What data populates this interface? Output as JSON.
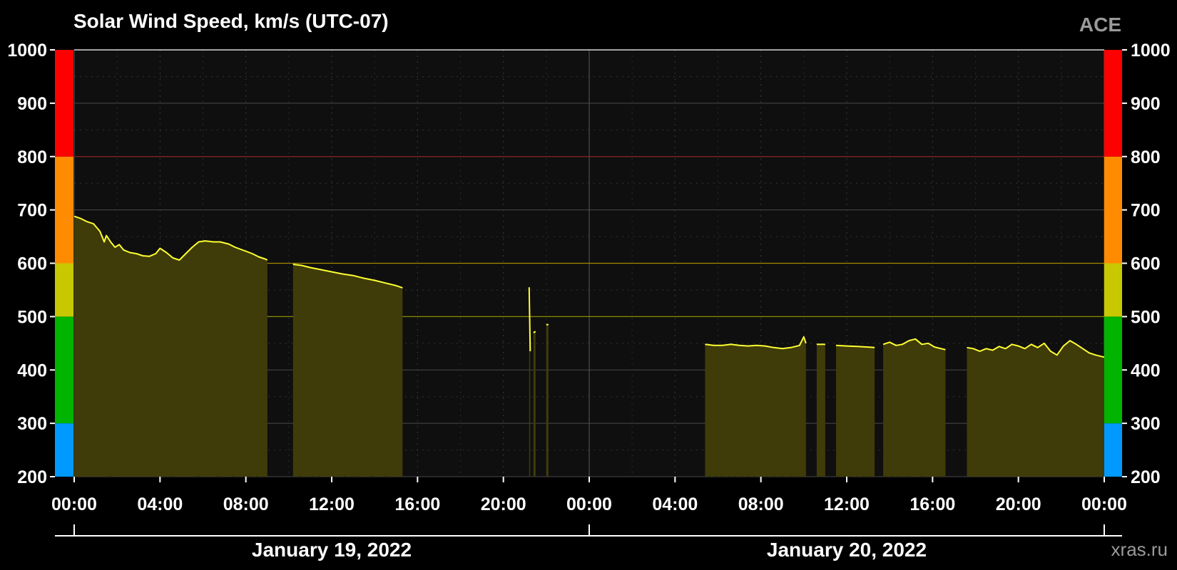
{
  "chart_data": {
    "type": "area",
    "title": "Solar Wind Speed, km/s (UTC-07)",
    "source_label": "ACE",
    "site_label": "xras.ru",
    "ylim": [
      200,
      1000
    ],
    "y_ticks": [
      "1000",
      "900",
      "800",
      "700",
      "600",
      "500",
      "400",
      "300",
      "200"
    ],
    "x_range_hours": [
      0,
      48
    ],
    "x_ticks": [
      "00:00",
      "04:00",
      "08:00",
      "12:00",
      "16:00",
      "20:00",
      "00:00",
      "04:00",
      "08:00",
      "12:00",
      "16:00",
      "20:00",
      "00:00"
    ],
    "dates": [
      "January 19, 2022",
      "January 20, 2022"
    ],
    "grid": true,
    "colors": {
      "line": "#ffff33",
      "fill": "#3f3c09",
      "plot_bg": "#0f0f0f",
      "grid": "#4a4a4a",
      "level_line_600": "#a48a00",
      "level_line_800": "#8a1e1e",
      "level_line_500": "#8a8a00"
    },
    "levels": [
      {
        "from": 200,
        "to": 300,
        "color": "#0099ff"
      },
      {
        "from": 300,
        "to": 500,
        "color": "#00b400"
      },
      {
        "from": 500,
        "to": 600,
        "color": "#c8c800"
      },
      {
        "from": 600,
        "to": 800,
        "color": "#ff8c00"
      },
      {
        "from": 800,
        "to": 1000,
        "color": "#ff0000"
      }
    ],
    "series": [
      {
        "segments": [
          [
            [
              0.0,
              688
            ],
            [
              0.3,
              684
            ],
            [
              0.6,
              678
            ],
            [
              0.9,
              674
            ],
            [
              1.2,
              660
            ],
            [
              1.4,
              640
            ],
            [
              1.5,
              652
            ],
            [
              1.7,
              640
            ],
            [
              1.9,
              630
            ],
            [
              2.1,
              635
            ],
            [
              2.3,
              625
            ],
            [
              2.6,
              620
            ],
            [
              2.9,
              618
            ],
            [
              3.2,
              614
            ],
            [
              3.5,
              613
            ],
            [
              3.8,
              618
            ],
            [
              4.0,
              628
            ],
            [
              4.3,
              620
            ],
            [
              4.6,
              610
            ],
            [
              4.9,
              606
            ],
            [
              5.2,
              618
            ],
            [
              5.5,
              630
            ],
            [
              5.8,
              640
            ],
            [
              6.1,
              642
            ],
            [
              6.5,
              640
            ],
            [
              6.8,
              640
            ],
            [
              7.2,
              636
            ],
            [
              7.5,
              630
            ],
            [
              7.9,
              624
            ],
            [
              8.3,
              618
            ],
            [
              8.6,
              612
            ],
            [
              8.9,
              608
            ],
            [
              9.0,
              606
            ]
          ],
          [
            [
              10.2,
              598
            ],
            [
              10.6,
              596
            ],
            [
              11.0,
              592
            ],
            [
              11.5,
              588
            ],
            [
              12.0,
              584
            ],
            [
              12.5,
              580
            ],
            [
              13.0,
              577
            ],
            [
              13.5,
              572
            ],
            [
              14.0,
              568
            ],
            [
              14.5,
              563
            ],
            [
              15.0,
              558
            ],
            [
              15.3,
              554
            ]
          ],
          [
            [
              21.2,
              555
            ],
            [
              21.25,
              435
            ]
          ],
          [
            [
              21.4,
              470
            ],
            [
              21.5,
              472
            ]
          ],
          [
            [
              22.0,
              485
            ],
            [
              22.1,
              485
            ]
          ],
          [
            [
              29.4,
              448
            ],
            [
              29.8,
              446
            ],
            [
              30.2,
              446
            ],
            [
              30.6,
              448
            ],
            [
              31.0,
              446
            ],
            [
              31.4,
              445
            ],
            [
              31.8,
              446
            ],
            [
              32.2,
              445
            ],
            [
              32.6,
              442
            ],
            [
              33.0,
              440
            ],
            [
              33.4,
              442
            ],
            [
              33.8,
              446
            ],
            [
              34.0,
              462
            ],
            [
              34.1,
              450
            ]
          ],
          [
            [
              34.6,
              448
            ],
            [
              35.0,
              448
            ]
          ],
          [
            [
              35.5,
              446
            ],
            [
              36.0,
              445
            ],
            [
              36.5,
              444
            ],
            [
              37.0,
              443
            ],
            [
              37.3,
              442
            ]
          ],
          [
            [
              37.7,
              448
            ],
            [
              38.0,
              452
            ],
            [
              38.3,
              446
            ],
            [
              38.6,
              448
            ],
            [
              38.9,
              455
            ],
            [
              39.2,
              458
            ],
            [
              39.5,
              448
            ],
            [
              39.8,
              450
            ],
            [
              40.1,
              443
            ],
            [
              40.4,
              440
            ],
            [
              40.6,
              438
            ]
          ],
          [
            [
              41.6,
              442
            ],
            [
              41.9,
              440
            ],
            [
              42.2,
              435
            ],
            [
              42.5,
              440
            ],
            [
              42.8,
              437
            ],
            [
              43.1,
              444
            ],
            [
              43.4,
              440
            ],
            [
              43.7,
              448
            ],
            [
              44.0,
              445
            ],
            [
              44.3,
              440
            ],
            [
              44.6,
              448
            ],
            [
              44.9,
              442
            ],
            [
              45.2,
              450
            ],
            [
              45.5,
              435
            ],
            [
              45.8,
              428
            ],
            [
              46.1,
              445
            ],
            [
              46.4,
              455
            ],
            [
              46.7,
              448
            ],
            [
              47.0,
              440
            ],
            [
              47.3,
              432
            ],
            [
              47.6,
              428
            ],
            [
              48.0,
              424
            ]
          ]
        ],
        "gaps": [
          [
            9.0,
            10.2
          ],
          [
            15.3,
            21.2
          ],
          [
            22.1,
            29.4
          ],
          [
            40.6,
            41.6
          ]
        ],
        "spikes": [
          1.7,
          4.6,
          5.8,
          6.7,
          7.4,
          7.9,
          8.2,
          8.5,
          10.5,
          11.1,
          11.4,
          12.1,
          12.6,
          13.2,
          13.9,
          14.5,
          21.3,
          21.6,
          29.6,
          29.9,
          30.2,
          30.5,
          30.8,
          31.1,
          31.4,
          31.7,
          32.0,
          32.3,
          32.6,
          33.0,
          33.4,
          33.7,
          34.3,
          35.2,
          35.6,
          35.9,
          36.2,
          36.5,
          36.8,
          37.1,
          37.4,
          37.8,
          38.1,
          38.4,
          38.9,
          39.5,
          40.4,
          41.4
        ]
      }
    ]
  }
}
